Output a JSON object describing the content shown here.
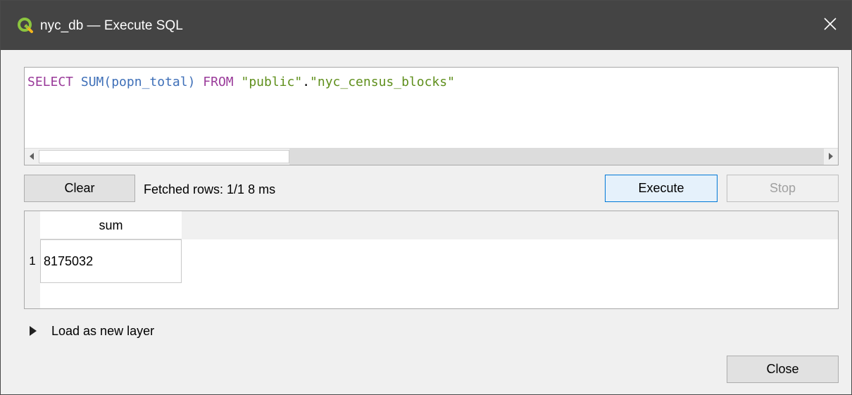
{
  "window": {
    "title": "nyc_db — Execute SQL"
  },
  "editor": {
    "tokens": {
      "select_kw": "SELECT",
      "sp1": " ",
      "sum_fn": "SUM(popn_total)",
      "sp2": " ",
      "from_kw": "FROM",
      "sp3": " ",
      "schema_str": "\"public\"",
      "dot": ".",
      "table_str": "\"nyc_census_blocks\""
    }
  },
  "toolbar": {
    "clear_label": "Clear",
    "status_text": "Fetched rows: 1/1  8 ms",
    "execute_label": "Execute",
    "stop_label": "Stop"
  },
  "results": {
    "columns": [
      "sum"
    ],
    "rows": [
      {
        "row_number": "1",
        "cells": [
          "8175032"
        ]
      }
    ]
  },
  "load_layer": {
    "label": "Load as new layer"
  },
  "footer": {
    "close_label": "Close"
  },
  "icons": {
    "app": "qgis-logo-icon",
    "close": "close-icon",
    "scroll_left": "chevron-left-icon",
    "scroll_right": "chevron-right-icon",
    "expand": "triangle-right-icon"
  },
  "colors": {
    "titlebar": "#444444",
    "keyword": "#9a3b9a",
    "function": "#3e6fb8",
    "string": "#5f8f1c",
    "default_button_border": "#0078d7"
  }
}
